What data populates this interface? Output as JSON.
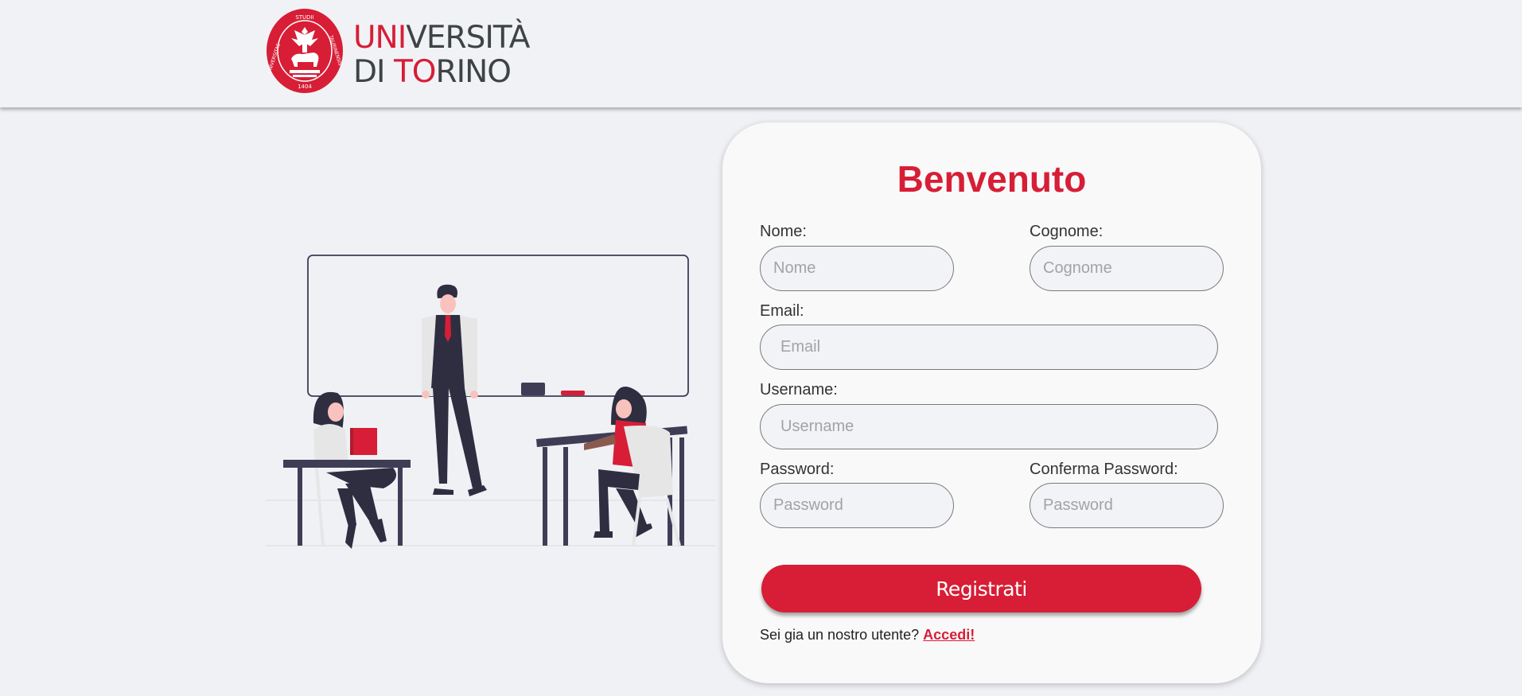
{
  "header": {
    "logo": {
      "line1_red": "UNI",
      "line1_grey": "VERSITÀ",
      "line2_grey_a": "DI ",
      "line2_red": "TO",
      "line2_grey_b": "RINO",
      "seal_text_left": "UNIVERSITAS",
      "seal_text_top": "STUDII",
      "seal_text_right": "TAURINENSIS",
      "seal_year": "1404"
    }
  },
  "colors": {
    "accent": "#d71e36",
    "dark_text": "#3e4346",
    "background": "#f0f1f5",
    "card": "#f9f9f9"
  },
  "illustration": {
    "name": "classroom-illustration"
  },
  "form": {
    "title": "Benvenuto",
    "nome": {
      "label": "Nome:",
      "placeholder": "Nome",
      "value": ""
    },
    "cognome": {
      "label": "Cognome:",
      "placeholder": "Cognome",
      "value": ""
    },
    "email": {
      "label": "Email:",
      "placeholder": "Email",
      "value": ""
    },
    "username": {
      "label": "Username:",
      "placeholder": "Username",
      "value": ""
    },
    "password": {
      "label": "Password:",
      "placeholder": "Password",
      "value": ""
    },
    "confirm_password": {
      "label": "Conferma Password:",
      "placeholder": "Password",
      "value": ""
    },
    "submit_label": "Registrati",
    "login_prompt": "Sei gia un nostro utente?",
    "login_link": "Accedi!"
  }
}
